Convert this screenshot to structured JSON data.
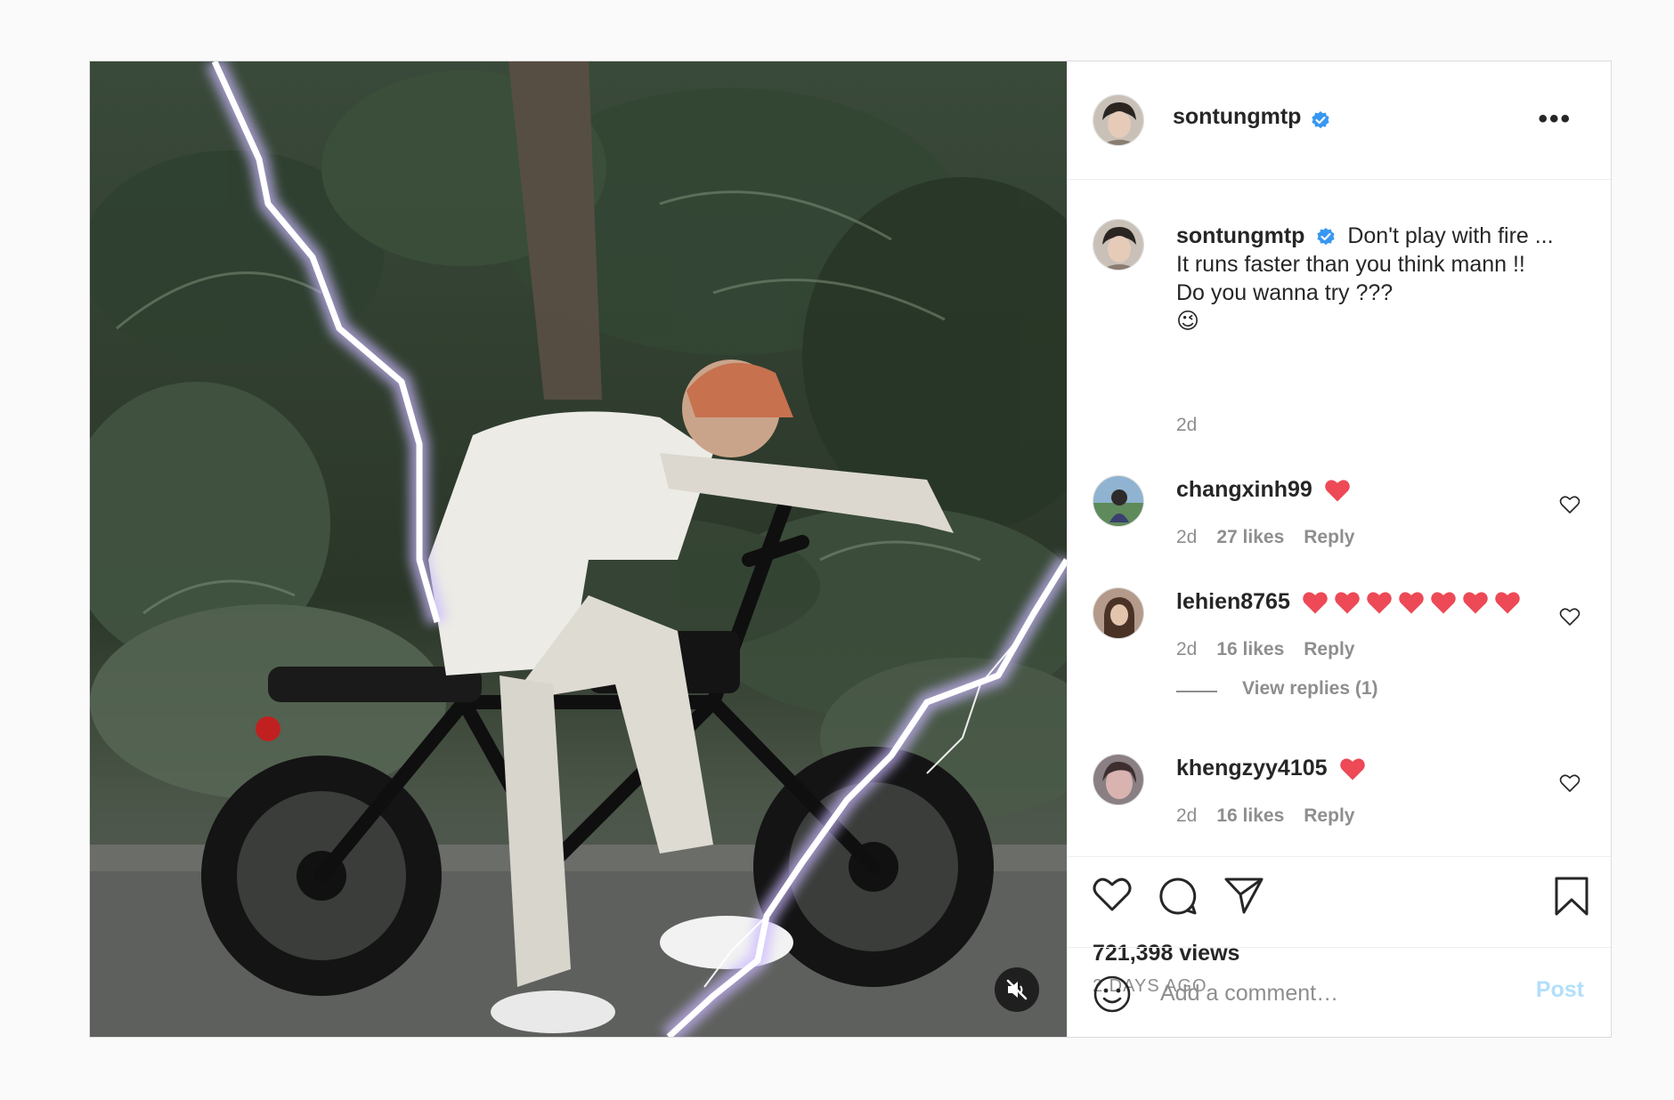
{
  "post": {
    "author": {
      "username": "sontungmtp",
      "verified": true
    },
    "caption": {
      "line1": "Don't play with fire ...",
      "line2": "It runs faster than you think mann !!",
      "line3": "Do you wanna try ???",
      "emoji": "😉",
      "time": "2d"
    },
    "media": {
      "type": "video",
      "muted": true,
      "icon": "speaker-muted-icon"
    },
    "more_icon": "more-options-icon",
    "more_label": "•••"
  },
  "comments": [
    {
      "username": "changxinh99",
      "text": "❤️",
      "hearts": 1,
      "time": "2d",
      "likes": "27 likes",
      "reply": "Reply"
    },
    {
      "username": "lehien8765",
      "text": "❤️❤️❤️❤️❤️❤️❤️",
      "hearts": 7,
      "time": "2d",
      "likes": "16 likes",
      "reply": "Reply",
      "view_replies": "View replies (1)"
    },
    {
      "username": "khengzyy4105",
      "text": "❤️",
      "hearts": 1,
      "time": "2d",
      "likes": "16 likes",
      "reply": "Reply"
    }
  ],
  "actions": {
    "icons": [
      "heart-icon",
      "comment-icon",
      "share-icon",
      "bookmark-icon"
    ],
    "views": "721,398 views",
    "posted": "2 DAYS AGO"
  },
  "add_comment": {
    "placeholder": "Add a comment…",
    "post_label": "Post",
    "emoji_icon": "smiley-icon"
  },
  "colors": {
    "verified": "#3897f0",
    "heart_red": "#ed4956",
    "post_button_disabled": "#b2dffc",
    "secondary_text": "#8e8e8e"
  }
}
